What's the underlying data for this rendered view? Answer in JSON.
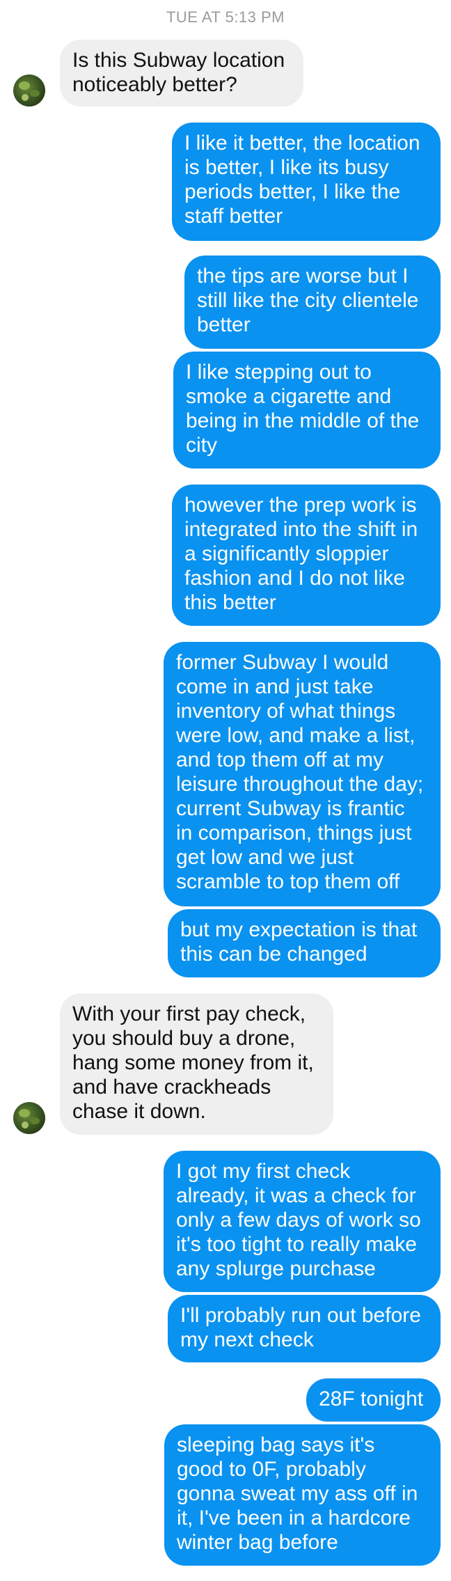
{
  "conversation": {
    "timestamp": "TUE AT 5:13 PM",
    "messages": [
      {
        "from": "them",
        "text": "Is this Subway location\nnoticeably better?"
      },
      {
        "from": "me",
        "text": "I like it better, the location\nis better, I like its busy\nperiods better, I like the\nstaff better"
      },
      {
        "from": "me",
        "text": "the tips are worse but I\nstill like the city clientele\nbetter"
      },
      {
        "from": "me",
        "text": "I like stepping out to\nsmoke a cigarette and\nbeing in the middle of the\ncity"
      },
      {
        "from": "me",
        "text": "however the prep work is\nintegrated into the shift in\na significantly sloppier\nfashion and I do not like\nthis better"
      },
      {
        "from": "me",
        "text": "former Subway I would\ncome in and just take\ninventory of what things\nwere low, and make a list,\nand top them off at my\nleisure throughout the day;\ncurrent Subway is frantic\nin comparison, things just\nget low and we just\nscramble to top them off"
      },
      {
        "from": "me",
        "text": "but my expectation is that\nthis can be changed"
      },
      {
        "from": "them",
        "text": "With your first pay check,\nyou should buy a drone,\nhang some money from it,\nand have crackheads\nchase it down."
      },
      {
        "from": "me",
        "text": "I got my first check\nalready, it was a check for\nonly a few days of work so\nit's too tight to really make\nany splurge purchase"
      },
      {
        "from": "me",
        "text": "I'll probably run out before\nmy next check"
      },
      {
        "from": "me",
        "text": "28F tonight"
      },
      {
        "from": "me",
        "text": "sleeping bag says it's\ngood to 0F, probably\ngonna sweat my ass off in\nit, I've been in a hardcore\nwinter bag before"
      }
    ]
  }
}
